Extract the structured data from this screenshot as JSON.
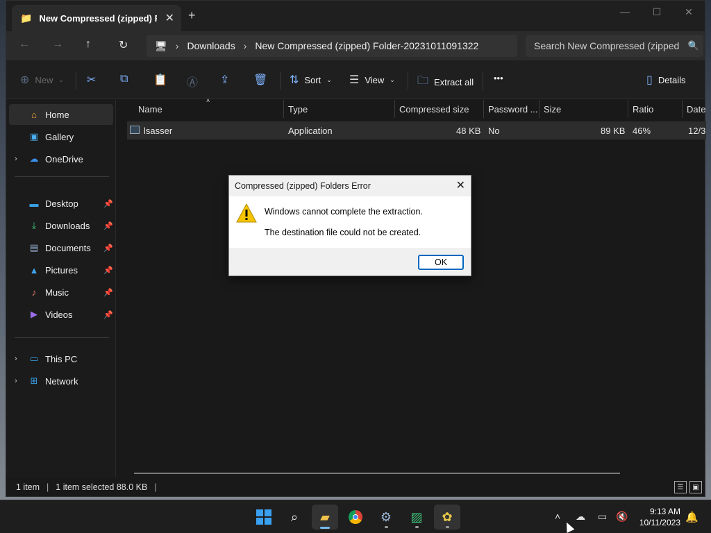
{
  "window": {
    "tab_title": "New Compressed (zipped) Fol",
    "address": {
      "root": "Downloads",
      "folder": "New Compressed (zipped) Folder-20231011091322"
    },
    "search_placeholder": "Search New Compressed (zipped"
  },
  "commands": {
    "new": "New",
    "sort": "Sort",
    "view": "View",
    "extract_all": "Extract all",
    "details": "Details"
  },
  "sidebar": {
    "items": [
      {
        "label": "Home",
        "icon": "home-icon"
      },
      {
        "label": "Gallery",
        "icon": "gallery-icon"
      },
      {
        "label": "OneDrive",
        "icon": "cloud-icon"
      },
      {
        "label": "Desktop",
        "icon": "desktop-icon"
      },
      {
        "label": "Downloads",
        "icon": "download-icon"
      },
      {
        "label": "Documents",
        "icon": "document-icon"
      },
      {
        "label": "Pictures",
        "icon": "pictures-icon"
      },
      {
        "label": "Music",
        "icon": "music-icon"
      },
      {
        "label": "Videos",
        "icon": "videos-icon"
      },
      {
        "label": "This PC",
        "icon": "pc-icon"
      },
      {
        "label": "Network",
        "icon": "network-icon"
      }
    ]
  },
  "columns": [
    "Name",
    "Type",
    "Compressed size",
    "Password ...",
    "Size",
    "Ratio",
    "Date"
  ],
  "files": [
    {
      "name": "lsasser",
      "type": "Application",
      "compressed_size": "48 KB",
      "password": "No",
      "size": "89 KB",
      "ratio": "46%",
      "date": "12/3"
    }
  ],
  "status": {
    "count": "1 item",
    "selected": "1 item selected  88.0 KB"
  },
  "dialog": {
    "title": "Compressed (zipped) Folders Error",
    "message1": "Windows cannot complete the extraction.",
    "message2": "The destination file could not be created.",
    "ok": "OK"
  },
  "taskbar": {
    "time": "9:13 AM",
    "date": "10/11/2023"
  },
  "colors": {
    "accent": "#0067c0",
    "warning": "#f5c400"
  }
}
